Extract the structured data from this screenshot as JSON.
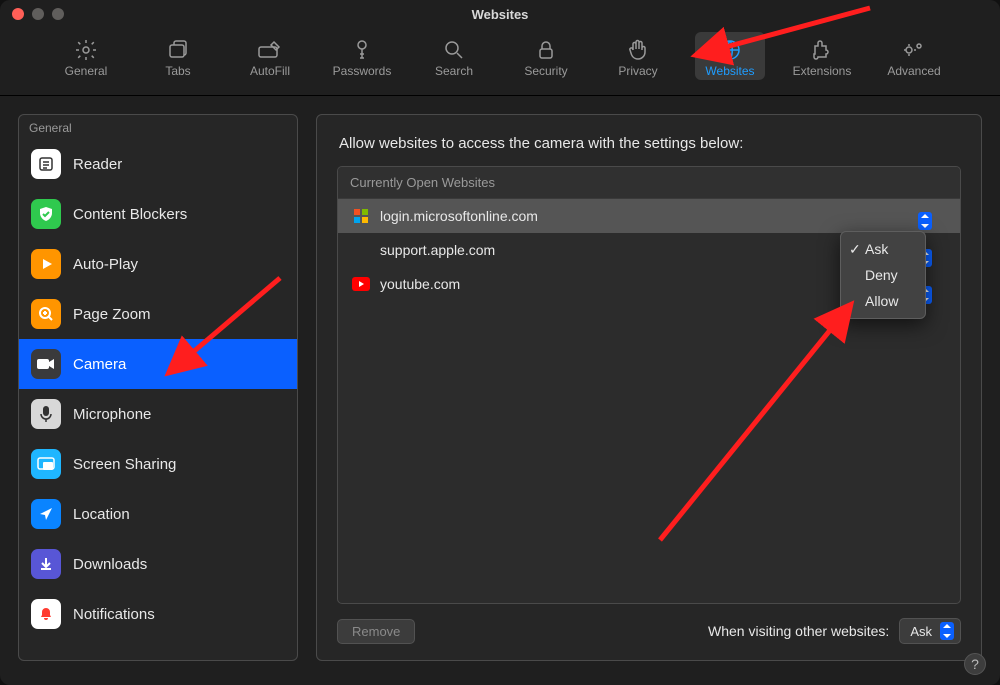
{
  "window": {
    "title": "Websites"
  },
  "toolbar": {
    "items": [
      {
        "key": "general",
        "label": "General"
      },
      {
        "key": "tabs",
        "label": "Tabs"
      },
      {
        "key": "autofill",
        "label": "AutoFill"
      },
      {
        "key": "passwords",
        "label": "Passwords"
      },
      {
        "key": "search",
        "label": "Search"
      },
      {
        "key": "security",
        "label": "Security"
      },
      {
        "key": "privacy",
        "label": "Privacy"
      },
      {
        "key": "websites",
        "label": "Websites",
        "active": true
      },
      {
        "key": "extensions",
        "label": "Extensions"
      },
      {
        "key": "advanced",
        "label": "Advanced"
      }
    ]
  },
  "sidebar": {
    "header": "General",
    "items": [
      {
        "key": "reader",
        "label": "Reader"
      },
      {
        "key": "content-blockers",
        "label": "Content Blockers"
      },
      {
        "key": "auto-play",
        "label": "Auto-Play"
      },
      {
        "key": "page-zoom",
        "label": "Page Zoom"
      },
      {
        "key": "camera",
        "label": "Camera",
        "selected": true
      },
      {
        "key": "microphone",
        "label": "Microphone"
      },
      {
        "key": "screen-sharing",
        "label": "Screen Sharing"
      },
      {
        "key": "location",
        "label": "Location"
      },
      {
        "key": "downloads",
        "label": "Downloads"
      },
      {
        "key": "notifications",
        "label": "Notifications"
      }
    ]
  },
  "main": {
    "intro": "Allow websites to access the camera with the settings below:",
    "list_header": "Currently Open Websites",
    "sites": [
      {
        "icon": "microsoft",
        "label": "login.microsoftonline.com",
        "selected": true
      },
      {
        "icon": "apple",
        "label": "support.apple.com"
      },
      {
        "icon": "youtube",
        "label": "youtube.com"
      }
    ],
    "remove_label": "Remove",
    "footer_label": "When visiting other websites:",
    "footer_value": "Ask"
  },
  "dropdown": {
    "options": [
      {
        "label": "Ask",
        "checked": true
      },
      {
        "label": "Deny"
      },
      {
        "label": "Allow"
      }
    ]
  }
}
